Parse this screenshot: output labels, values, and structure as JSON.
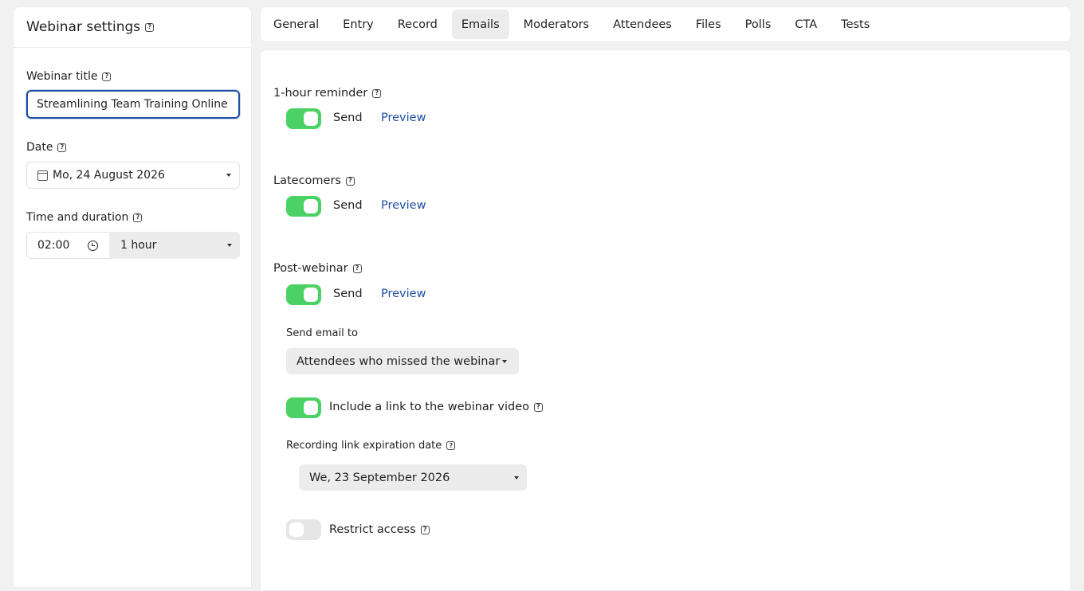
{
  "sidebar": {
    "title": "Webinar settings",
    "webinar_title_label": "Webinar title",
    "webinar_title_value": "Streamlining Team Training Online",
    "date_label": "Date",
    "date_value": "Mo, 24 August 2026",
    "time_label": "Time and duration",
    "time_value": "02:00",
    "duration_value": "1 hour"
  },
  "tabs": [
    {
      "label": "General"
    },
    {
      "label": "Entry"
    },
    {
      "label": "Record"
    },
    {
      "label": "Emails",
      "active": true
    },
    {
      "label": "Moderators"
    },
    {
      "label": "Attendees"
    },
    {
      "label": "Files"
    },
    {
      "label": "Polls"
    },
    {
      "label": "CTA"
    },
    {
      "label": "Tests"
    }
  ],
  "emails": {
    "reminder": {
      "label": "1-hour reminder",
      "send_label": "Send",
      "preview_label": "Preview",
      "enabled": true
    },
    "latecomers": {
      "label": "Latecomers",
      "send_label": "Send",
      "preview_label": "Preview",
      "enabled": true
    },
    "post_webinar": {
      "label": "Post-webinar",
      "send_label": "Send",
      "preview_label": "Preview",
      "enabled": true,
      "send_to_label": "Send email to",
      "send_to_value": "Attendees who missed the webinar",
      "include_link_label": "Include a link to the webinar video",
      "include_link_enabled": true,
      "expiration_label": "Recording link expiration date",
      "expiration_value": "We, 23 September 2026",
      "restrict_label": "Restrict access",
      "restrict_enabled": false
    }
  },
  "colors": {
    "accent": "#1f4fa0",
    "toggle_on": "#4cd264",
    "toggle_off": "#e6e6e6"
  }
}
